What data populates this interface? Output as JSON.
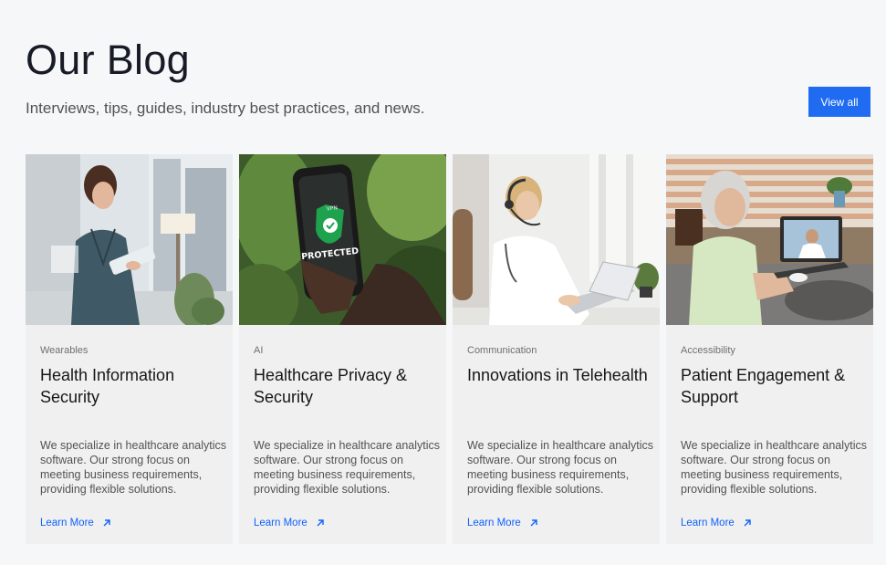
{
  "header": {
    "title": "Our Blog",
    "subtitle": "Interviews, tips, guides, industry best practices, and news.",
    "view_all_label": "View all"
  },
  "cards": [
    {
      "image": "nurse-with-tablet-photo",
      "category": "Wearables",
      "title": "Health Information Security",
      "description": "We specialize in healthcare analytics software. Our strong focus on meeting business requirements, providing flexible solutions.",
      "link_label": "Learn More"
    },
    {
      "image": "phone-vpn-protected-photo",
      "category": "AI",
      "title": "Healthcare Privacy & Security",
      "description": "We specialize in healthcare analytics software. Our strong focus on meeting business requirements, providing flexible solutions.",
      "link_label": "Learn More",
      "image_text_1": "VPN",
      "image_text_2": "PROTECTED"
    },
    {
      "image": "doctor-with-headset-laptop-photo",
      "category": "Communication",
      "title": "Innovations in Telehealth",
      "description": "We specialize in healthcare analytics software. Our strong focus on meeting business requirements, providing flexible solutions.",
      "link_label": "Learn More"
    },
    {
      "image": "senior-woman-video-call-photo",
      "category": "Accessibility",
      "title": "Patient Engagement & Support",
      "description": "We specialize in healthcare analytics software. Our strong focus on meeting business requirements, providing flexible solutions.",
      "link_label": "Learn More"
    }
  ],
  "colors": {
    "accent": "#1f6bf2",
    "link": "#0f62fe",
    "card_bg": "#f0f0f0",
    "page_bg": "#f6f7f9"
  }
}
